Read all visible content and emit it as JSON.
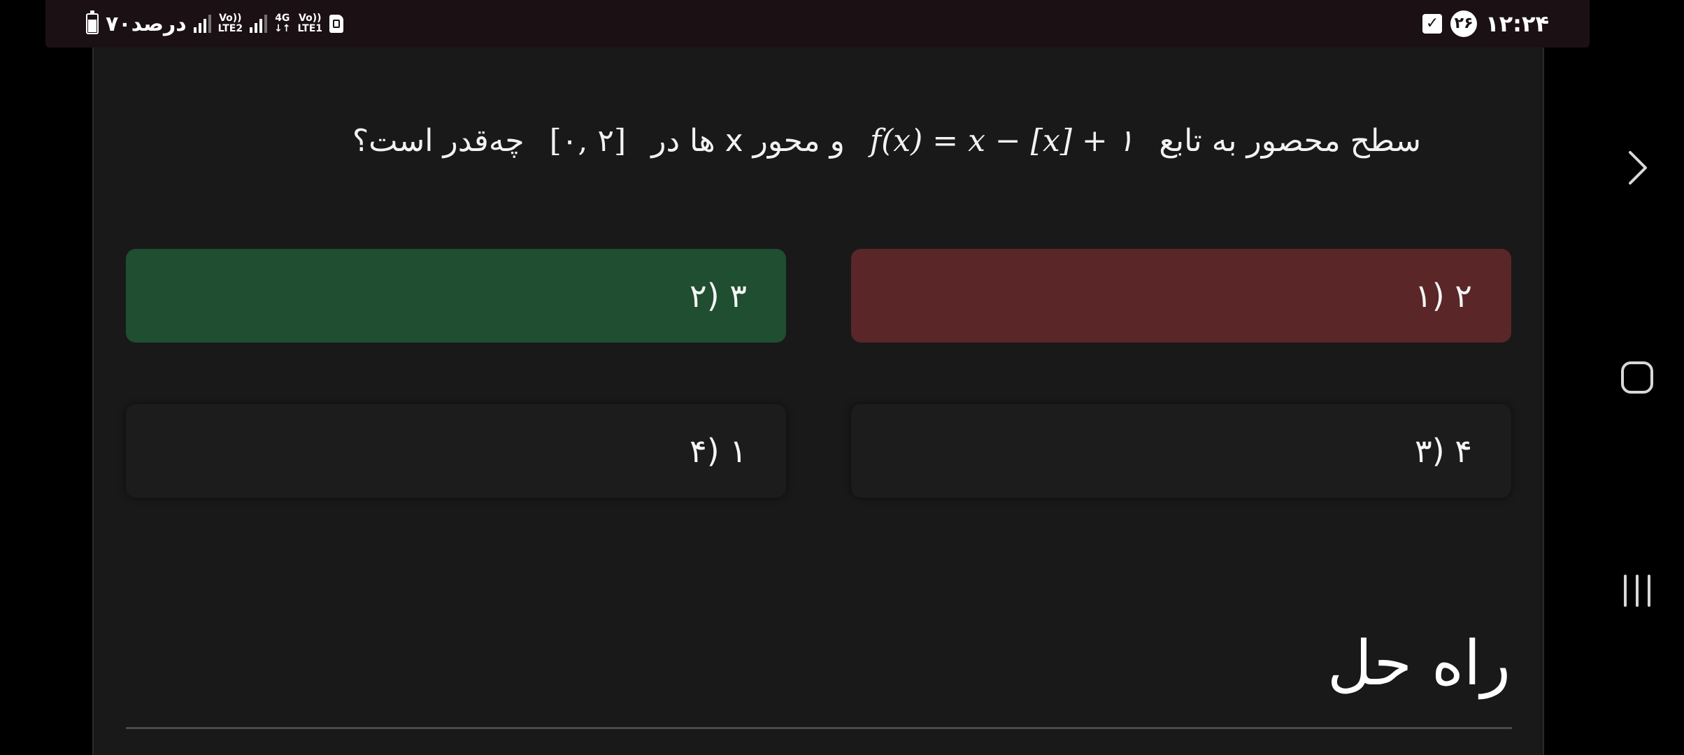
{
  "status_bar": {
    "battery_text": "۷۰درصد",
    "network_1_top": "Vo))",
    "network_1_bottom": "LTE2",
    "network_2_top": "4G",
    "network_2_bottom": "↓↑",
    "network_3_top": "Vo))",
    "network_3_bottom": "LTE1",
    "notification_count": "۲۶",
    "time": "۱۲:۲۴"
  },
  "question": {
    "text_part_1": "سطح محصور به تابع",
    "formula": "f(x) = x − [x] + ۱",
    "text_part_2": "و محور x ها در",
    "interval": "[۰, ۲]",
    "text_part_3": "چه‌قدر است؟"
  },
  "options": [
    {
      "label": "۲ (۱",
      "state": "wrong"
    },
    {
      "label": "۳ (۲",
      "state": "correct"
    },
    {
      "label": "۴ (۳",
      "state": "neutral"
    },
    {
      "label": "۱ (۴",
      "state": "neutral"
    }
  ],
  "solution": {
    "title": "راه حل"
  },
  "colors": {
    "wrong": "#5a2627",
    "correct": "#1f4e30",
    "panel": "#191919",
    "status_bar": "#1b1114"
  },
  "nav": {
    "forward_icon": "chevron-right-icon",
    "home_icon": "home-square-icon",
    "recents_icon": "recents-bars-icon"
  }
}
